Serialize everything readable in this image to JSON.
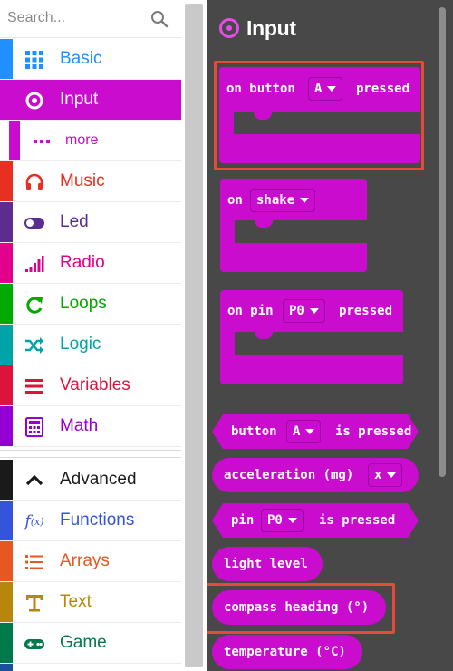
{
  "search": {
    "placeholder": "Search..."
  },
  "categories": [
    {
      "label": "Basic",
      "icon": "grid-icon",
      "color": "#1e90ff"
    },
    {
      "label": "Input",
      "icon": "target-icon",
      "color": "#c90cce",
      "selected": true
    },
    {
      "label": "more",
      "icon": "dots-icon",
      "color": "#c90cce",
      "sub": true
    },
    {
      "label": "Music",
      "icon": "headphones-icon",
      "color": "#e63022"
    },
    {
      "label": "Led",
      "icon": "toggle-icon",
      "color": "#5c2d91"
    },
    {
      "label": "Radio",
      "icon": "signal-bars-icon",
      "color": "#e3008c"
    },
    {
      "label": "Loops",
      "icon": "refresh-icon",
      "color": "#00aa00"
    },
    {
      "label": "Logic",
      "icon": "shuffle-icon",
      "color": "#00a4a6"
    },
    {
      "label": "Variables",
      "icon": "list-icon",
      "color": "#dc143c"
    },
    {
      "label": "Math",
      "icon": "calculator-icon",
      "color": "#9400d3"
    },
    {
      "label": "Advanced",
      "icon": "chevron-up-icon",
      "color": "#1a1a1a"
    },
    {
      "label": "Functions",
      "icon": "function-icon",
      "color": "#3455db"
    },
    {
      "label": "Arrays",
      "icon": "array-list-icon",
      "color": "#e65722"
    },
    {
      "label": "Text",
      "icon": "text-icon",
      "color": "#b8860b"
    },
    {
      "label": "Game",
      "icon": "gamepad-icon",
      "color": "#007a4b"
    }
  ],
  "flyout": {
    "title": "Input",
    "accent": "#c90cce",
    "blocks": {
      "on_button": {
        "pre": "on button",
        "dropdown": "A",
        "post": "pressed"
      },
      "on_shake": {
        "pre": "on",
        "dropdown": "shake"
      },
      "on_pin": {
        "pre": "on pin",
        "dropdown": "P0",
        "post": "pressed"
      },
      "button_is_pressed": {
        "pre": "button",
        "dropdown": "A",
        "post": "is pressed"
      },
      "acceleration": {
        "pre": "acceleration (mg)",
        "dropdown": "x"
      },
      "pin_is_pressed": {
        "pre": "pin",
        "dropdown": "P0",
        "post": "is pressed"
      },
      "light_level": {
        "label": "light level"
      },
      "compass_heading": {
        "label": "compass heading (°)"
      },
      "temperature": {
        "label": "temperature (°C)"
      }
    }
  }
}
